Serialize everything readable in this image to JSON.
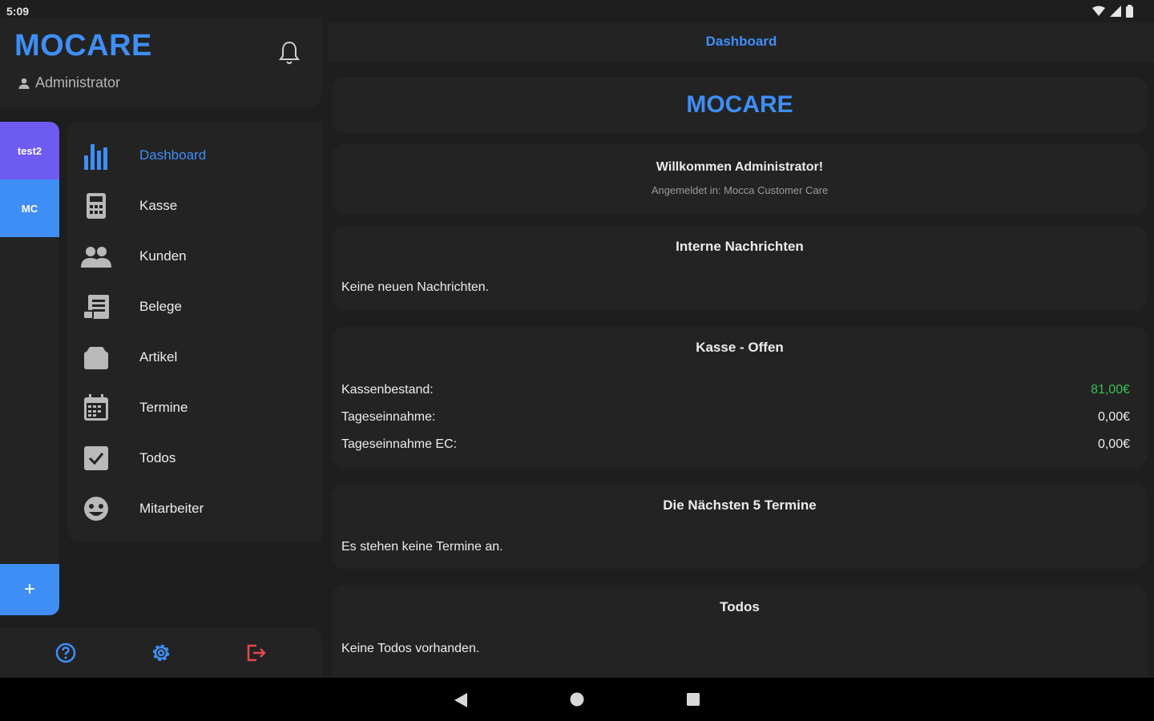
{
  "status": {
    "time": "5:09"
  },
  "sidebar": {
    "brand": "MOCARE",
    "role": "Administrator",
    "companies": [
      "test2",
      "MC"
    ],
    "add_label": "+",
    "nav": [
      {
        "label": "Dashboard",
        "icon": "bar-chart-icon",
        "active": true
      },
      {
        "label": "Kasse",
        "icon": "calculator-icon"
      },
      {
        "label": "Kunden",
        "icon": "people-icon"
      },
      {
        "label": "Belege",
        "icon": "receipt-icon"
      },
      {
        "label": "Artikel",
        "icon": "box-icon"
      },
      {
        "label": "Termine",
        "icon": "calendar-icon"
      },
      {
        "label": "Todos",
        "icon": "checkbox-icon"
      },
      {
        "label": "Mitarbeiter",
        "icon": "face-icon"
      }
    ]
  },
  "main": {
    "page_title": "Dashboard",
    "hero_title": "MOCARE",
    "welcome": {
      "title": "Willkommen Administrator!",
      "subtitle": "Angemeldet in: Mocca Customer Care"
    },
    "messages": {
      "title": "Interne Nachrichten",
      "text": "Keine neuen Nachrichten."
    },
    "kasse": {
      "title": "Kasse - Offen",
      "rows": [
        {
          "label": "Kassenbestand:",
          "value": "81,00€"
        },
        {
          "label": "Tageseinnahme:",
          "value": "0,00€"
        },
        {
          "label": "Tageseinnahme EC:",
          "value": "0,00€"
        }
      ]
    },
    "termine": {
      "title": "Die Nächsten 5 Termine",
      "text": "Es stehen keine Termine an."
    },
    "todos": {
      "title": "Todos",
      "text": "Keine Todos vorhanden."
    }
  },
  "colors": {
    "accent": "#3f8ef5",
    "purple": "#6e5bf2",
    "positive": "#34c24f",
    "logout": "#e5484d"
  }
}
